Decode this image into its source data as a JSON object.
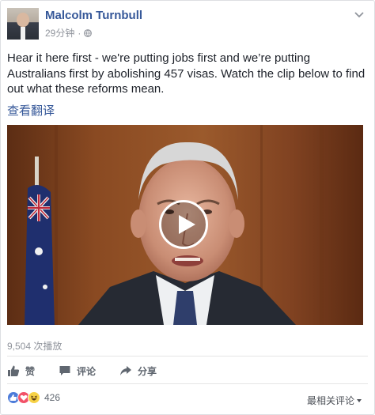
{
  "post": {
    "author": "Malcolm Turnbull",
    "time": "29分钟",
    "separator": "·",
    "privacy_icon": "globe-icon",
    "text": "Hear it here first - we're putting jobs first and we’re putting Australians first by abolishing 457 visas. Watch the clip below to find out what these reforms mean.",
    "translate_link": "查看翻译"
  },
  "video": {
    "play_icon": "play-icon",
    "views": "9,504 次播放"
  },
  "actions": {
    "like": "赞",
    "comment": "评论",
    "share": "分享"
  },
  "reactions": {
    "icons": [
      "like-reaction-icon",
      "love-reaction-icon",
      "haha-reaction-icon"
    ],
    "count": "426"
  },
  "comments": {
    "sort_label": "最相关评论"
  },
  "colors": {
    "link": "#365899",
    "muted": "#90949c",
    "text": "#1d2129",
    "border": "#dddfe2"
  }
}
